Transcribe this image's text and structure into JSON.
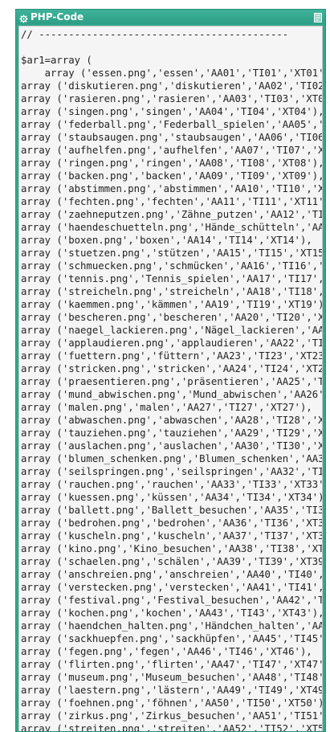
{
  "header": {
    "title": "PHP-Code",
    "icon": "gear-icon",
    "select_icon": "select-all-icon"
  },
  "code_lines": [
    "// ------------------------------------------",
    "",
    "$ar1=array (",
    "    array ('essen.png','essen','AA01','TI01','XT01'",
    "array ('diskutieren.png','diskutieren','AA02','TI02",
    "array ('rasieren.png','rasieren','AA03','TI03','XT0",
    "array ('singen.png','singen','AA04','TI04','XT04'),",
    "array ('federball.png','Federball_spielen','AA05','",
    "array ('staubsaugen.png','staubsaugen','AA06','TI06",
    "array ('aufhelfen.png','aufhelfen','AA07','TI07','X",
    "array ('ringen.png','ringen','AA08','TI08','XT08'),",
    "array ('backen.png','backen','AA09','TI09','XT09'),",
    "array ('abstimmen.png','abstimmen','AA10','TI10','X",
    "array ('fechten.png','fechten','AA11','TI11','XT11'",
    "array ('zaehneputzen.png','Zähne_putzen','AA12','TI",
    "array ('haendeschuetteln.png','Hände_schütteln','AA",
    "array ('boxen.png','boxen','AA14','TI14','XT14'),",
    "array ('stuetzen.png','stützen','AA15','TI15','XT15",
    "array ('schmuecken.png','schmücken','AA16','TI16','",
    "array ('tennis.png','Tennis_spielen','AA17','TI17',",
    "array ('streicheln.png','streicheln','AA18','TI18',",
    "array ('kaemmen.png','kämmen','AA19','TI19','XT19')",
    "array ('bescheren.png','bescheren','AA20','TI20','X",
    "array ('naegel_lackieren.png','Nägel_lackieren','AA",
    "array ('applaudieren.png','applaudieren','AA22','TI",
    "array ('fuettern.png','füttern','AA23','TI23','XT23",
    "array ('stricken.png','stricken','AA24','TI24','XT2",
    "array ('praesentieren.png','präsentieren','AA25','T",
    "array ('mund_abwischen.png','Mund_abwischen','AA26'",
    "array ('malen.png','malen','AA27','TI27','XT27'),",
    "array ('abwaschen.png','abwaschen','AA28','TI28','X",
    "array ('tauziehen.png','tauziehen','AA29','TI29','X",
    "array ('auslachen.png','auslachen','AA30','TI30','X",
    "array ('blumen_schenken.png','Blumen_schenken','AA3",
    "array ('seilspringen.png','seilspringen','AA32','TI",
    "array ('rauchen.png','rauchen','AA33','TI33','XT33'",
    "array ('kuessen.png','küssen','AA34','TI34','XT34')",
    "array ('ballett.png','Ballett_besuchen','AA35','TI3",
    "array ('bedrohen.png','bedrohen','AA36','TI36','XT3",
    "array ('kuscheln.png','kuscheln','AA37','TI37','XT3",
    "array ('kino.png','Kino_besuchen','AA38','TI38','XT",
    "array ('schaelen.png','schälen','AA39','TI39','XT39",
    "array ('anschreien.png','anschreien','AA40','TI40',",
    "array ('verstecken.png','verstecken','AA41','TI41',",
    "array ('festival.png','Festival_besuchen','AA42','T",
    "array ('kochen.png','kochen','AA43','TI43','XT43'),",
    "array ('haendchen_halten.png','Händchen_halten','AA",
    "array ('sackhuepfen.png','sackhüpfen','AA45','TI45'",
    "array ('fegen.png','fegen','AA46','TI46','XT46'),",
    "array ('flirten.png','flirten','AA47','TI47','XT47'",
    "array ('museum.png','Museum_besuchen','AA48','TI48'",
    "array ('laestern.png','lästern','AA49','TI49','XT49",
    "array ('foehnen.png','föhnen','AA50','TI50','XT50')",
    "array ('zirkus.png','Zirkus_besuchen','AA51','TI51'",
    "array ('streiten.png','streiten','AA52','TI52','XT5"
  ]
}
